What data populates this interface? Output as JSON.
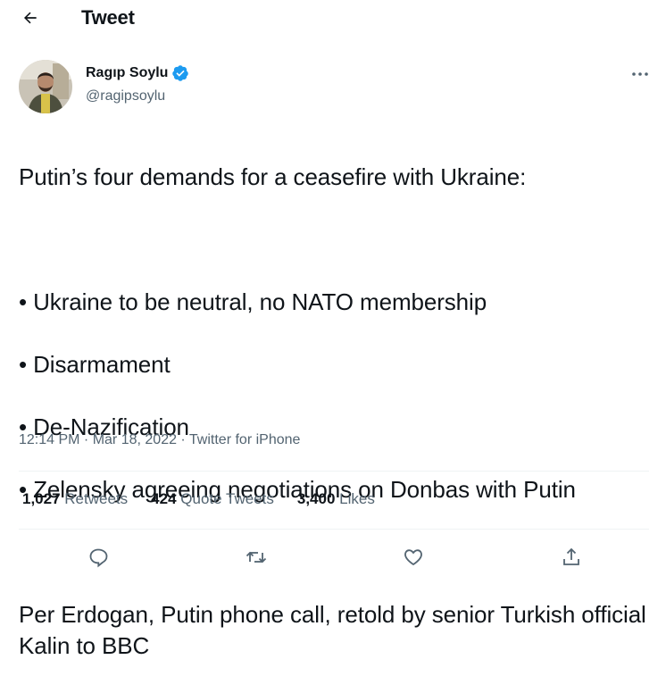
{
  "header": {
    "title": "Tweet"
  },
  "author": {
    "name": "Ragıp Soylu",
    "handle": "@ragipsoylu"
  },
  "tweet": {
    "lines": [
      "Putin’s four demands for a ceasefire with Ukraine:",
      "",
      "• Ukraine to be neutral, no NATO membership",
      "• Disarmament",
      "• De-Nazification",
      "• Zelensky agreeing negotiations on Donbas with Putin",
      "",
      "Per Erdogan, Putin phone call, retold by senior Turkish official Kalin to BBC"
    ],
    "timestamp": "12:14 PM · Mar 18, 2022 · Twitter for iPhone"
  },
  "stats": {
    "retweets_count": "1,027",
    "retweets_label": "Retweets",
    "quotes_count": "424",
    "quotes_label": "Quote Tweets",
    "likes_count": "3,400",
    "likes_label": "Likes"
  },
  "colors": {
    "verified": "#1d9bf0",
    "muted": "#536471",
    "text": "#0f1419"
  }
}
